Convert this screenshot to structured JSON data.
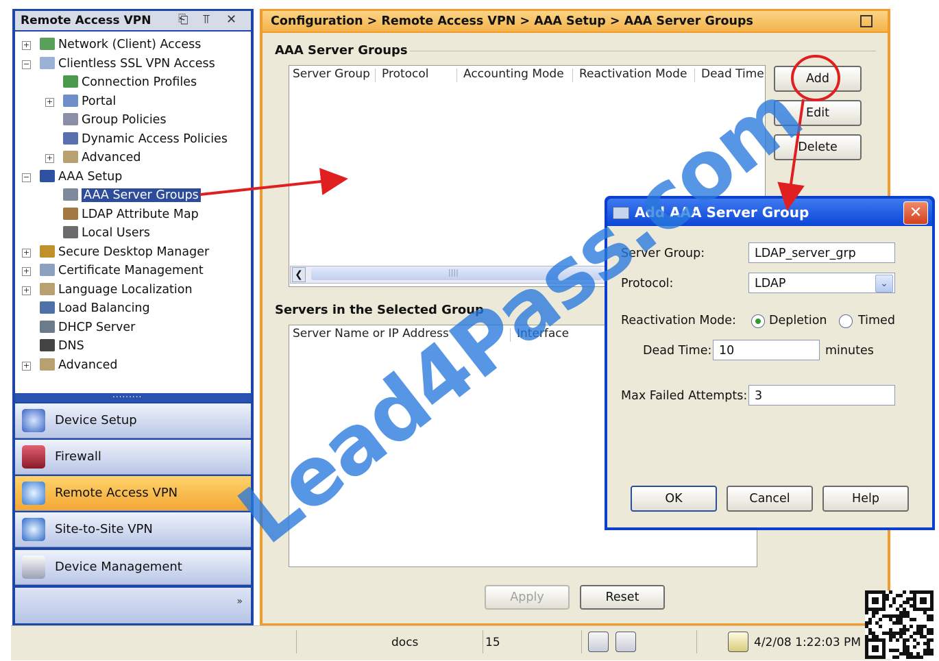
{
  "left_panel": {
    "title": "Remote Access VPN",
    "header_icons": [
      "dock-icon",
      "pin-icon",
      "close-icon"
    ],
    "tree": [
      {
        "label": "Network (Client) Access",
        "icon": "network-icon",
        "expander": "+"
      },
      {
        "label": "Clientless SSL VPN Access",
        "icon": "clientless-icon",
        "expander": "-"
      },
      {
        "label": "Connection Profiles",
        "icon": "connection-icon",
        "expander": ""
      },
      {
        "label": "Portal",
        "icon": "portal-icon",
        "expander": "+"
      },
      {
        "label": "Group Policies",
        "icon": "group-policy-icon",
        "expander": ""
      },
      {
        "label": "Dynamic Access Policies",
        "icon": "dap-icon",
        "expander": ""
      },
      {
        "label": "Advanced",
        "icon": "advanced-icon",
        "expander": "+"
      },
      {
        "label": "AAA Setup",
        "icon": "lock-icon",
        "expander": "-"
      },
      {
        "label": "AAA Server Groups",
        "icon": "server-group-icon",
        "expander": "",
        "selected": true
      },
      {
        "label": "LDAP Attribute Map",
        "icon": "ldap-map-icon",
        "expander": ""
      },
      {
        "label": "Local Users",
        "icon": "local-users-icon",
        "expander": ""
      },
      {
        "label": "Secure Desktop Manager",
        "icon": "secure-desktop-icon",
        "expander": "+"
      },
      {
        "label": "Certificate Management",
        "icon": "certificate-icon",
        "expander": "+"
      },
      {
        "label": "Language Localization",
        "icon": "language-icon",
        "expander": "+"
      },
      {
        "label": "Load Balancing",
        "icon": "load-balancing-icon",
        "expander": ""
      },
      {
        "label": "DHCP Server",
        "icon": "dhcp-icon",
        "expander": ""
      },
      {
        "label": "DNS",
        "icon": "dns-icon",
        "expander": ""
      },
      {
        "label": "Advanced",
        "icon": "advanced-icon",
        "expander": "+"
      }
    ],
    "nav_buttons": [
      {
        "label": "Device Setup",
        "icon": "device-setup-icon"
      },
      {
        "label": "Firewall",
        "icon": "firewall-icon"
      },
      {
        "label": "Remote Access VPN",
        "icon": "remote-vpn-icon",
        "active": true
      },
      {
        "label": "Site-to-Site VPN",
        "icon": "site-vpn-icon"
      },
      {
        "label": "Device Management",
        "icon": "device-management-icon"
      }
    ]
  },
  "main": {
    "breadcrumb": "Configuration > Remote Access VPN > AAA Setup > AAA Server Groups",
    "groups_section_title": "AAA Server Groups",
    "groups_columns": [
      "Server Group",
      "Protocol",
      "Accounting Mode",
      "Reactivation Mode",
      "Dead Time"
    ],
    "buttons": {
      "add": "Add",
      "edit": "Edit",
      "delete": "Delete"
    },
    "servers_section_title": "Servers in the Selected Group",
    "servers_columns": [
      "Server Name or IP Address",
      "Interface"
    ],
    "apply": "Apply",
    "reset": "Reset"
  },
  "dialog": {
    "title": "Add AAA Server Group",
    "server_group_label": "Server Group:",
    "server_group_value": "LDAP_server_grp",
    "protocol_label": "Protocol:",
    "protocol_value": "LDAP",
    "reactivation_label": "Reactivation Mode:",
    "depletion_label": "Depletion",
    "timed_label": "Timed",
    "reactivation_selected": "Depletion",
    "dead_time_label": "Dead Time:",
    "dead_time_value": "10",
    "dead_time_unit": "minutes",
    "max_failed_label": "Max Failed Attempts:",
    "max_failed_value": "3",
    "ok": "OK",
    "cancel": "Cancel",
    "help": "Help"
  },
  "status_bar": {
    "user": "docs",
    "privilege": "15",
    "datetime": "4/2/08 1:22:03 PM"
  },
  "watermark": "Lead4Pass.com",
  "colors": {
    "annotation": "#e02020",
    "active_nav": "#f3a735",
    "selection": "#2d4d9a"
  }
}
